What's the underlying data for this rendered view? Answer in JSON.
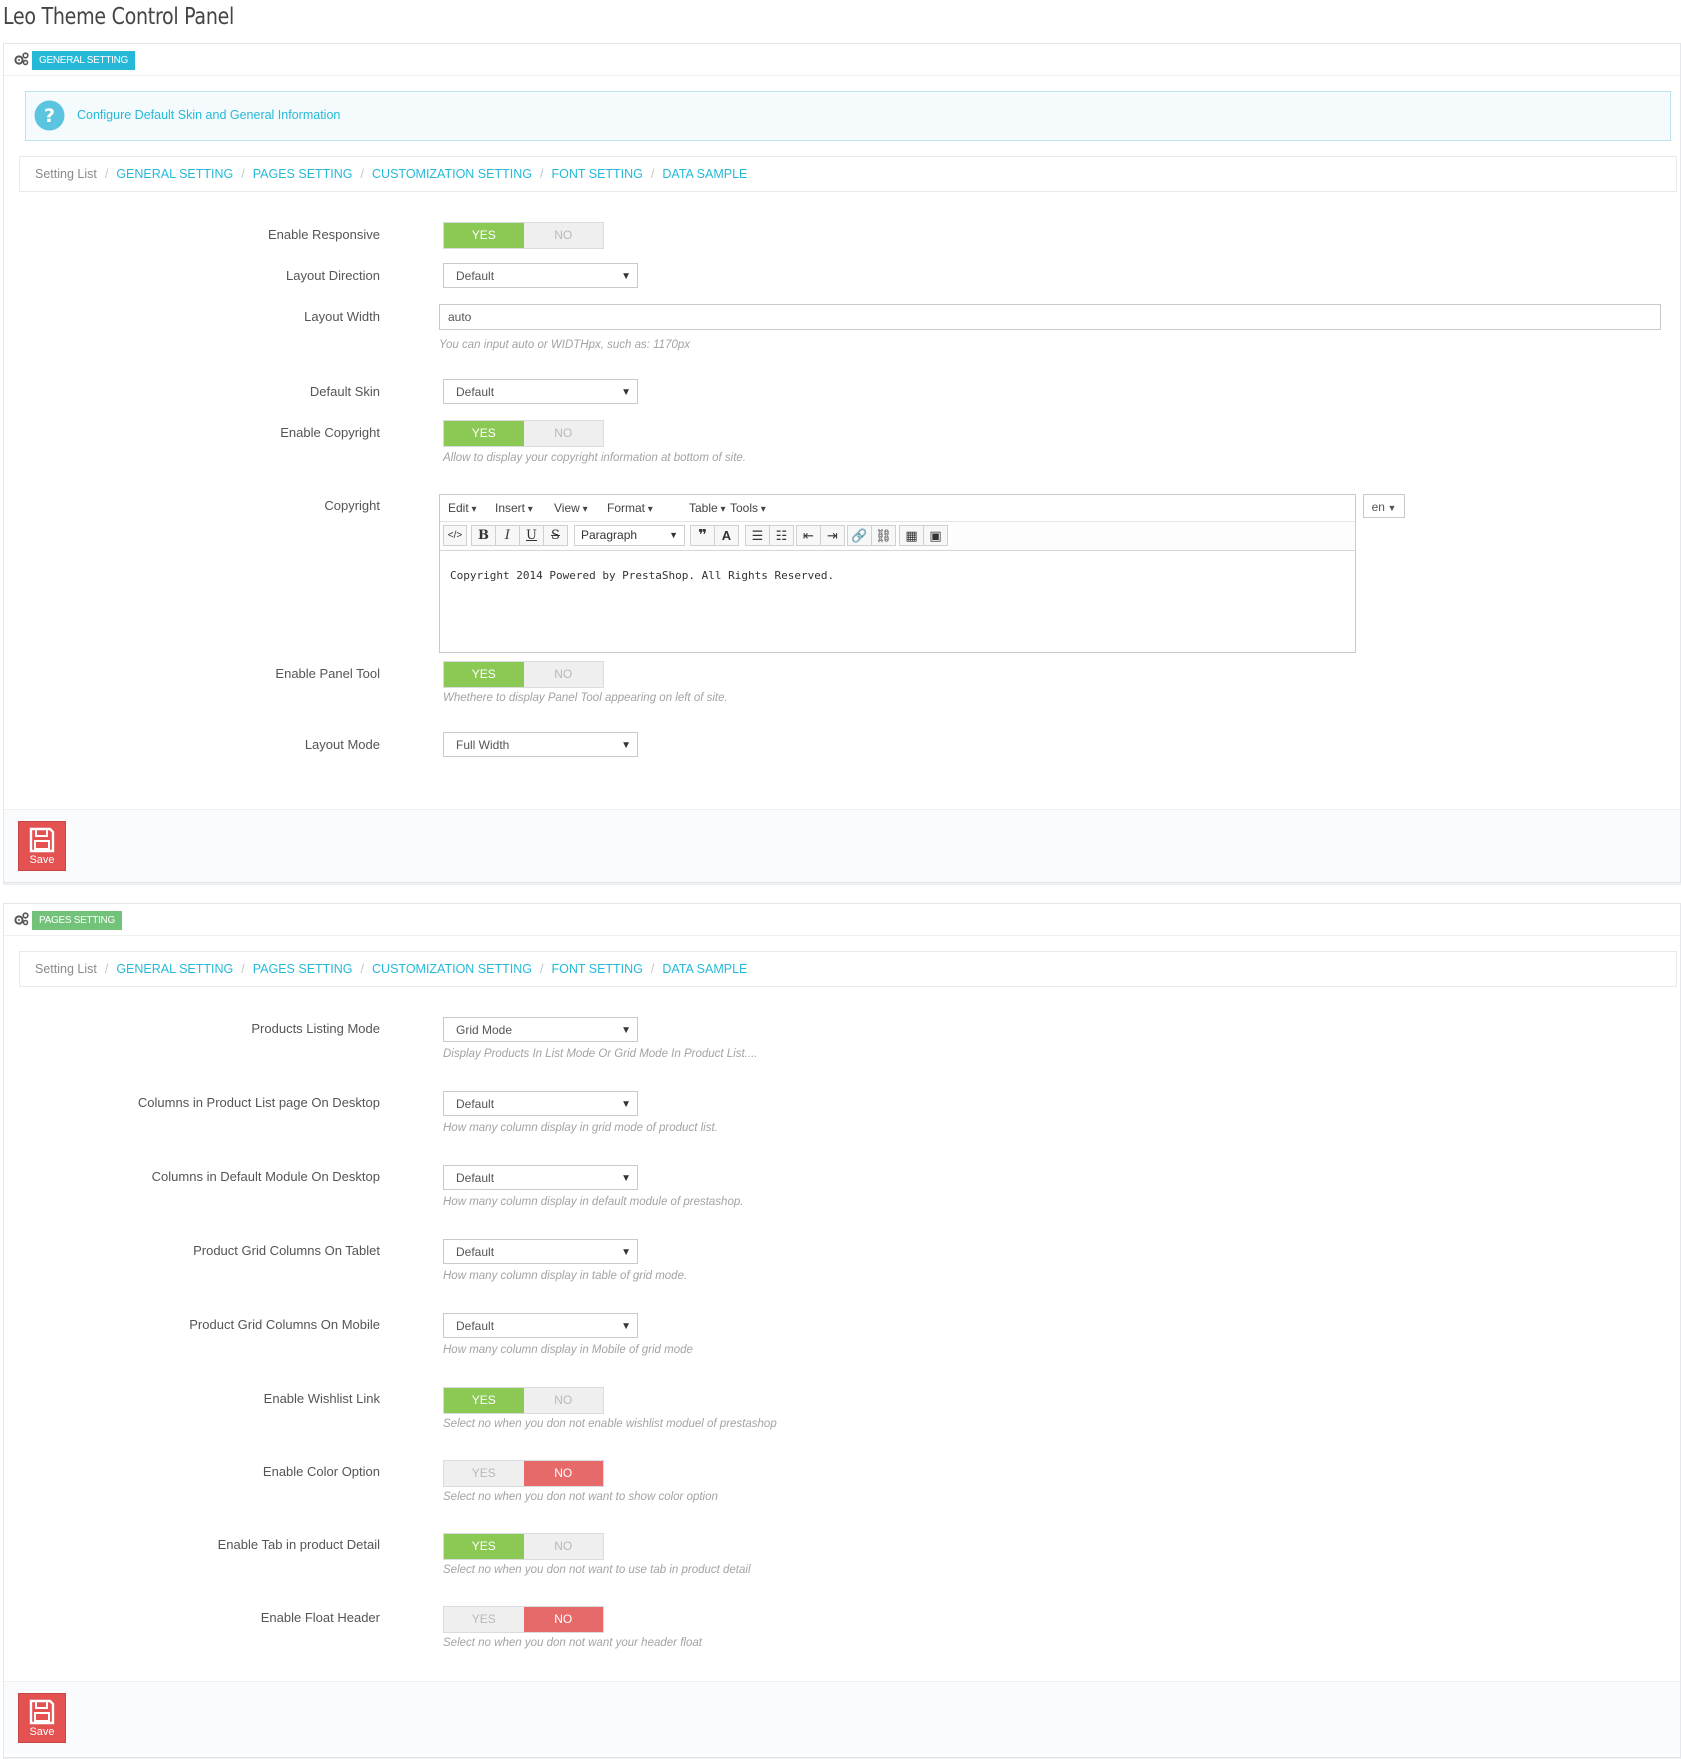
{
  "title": "Leo Theme Control Panel",
  "colors": {
    "accent": "#25b9d7",
    "yes": "#8bc954",
    "no": "#e76a6a",
    "save": "#e35151",
    "pages_badge": "#72c279"
  },
  "breadcrumb": {
    "home": "Setting List",
    "links": [
      "GENERAL SETTING",
      "PAGES SETTING",
      "CUSTOMIZATION SETTING",
      "FONT SETTING",
      "DATA SAMPLE"
    ]
  },
  "general": {
    "badge": "GENERAL SETTING",
    "info": "Configure Default Skin and General Information",
    "enable_responsive": {
      "label": "Enable Responsive",
      "yes": "YES",
      "no": "NO",
      "value": "yes"
    },
    "layout_direction": {
      "label": "Layout Direction",
      "value": "Default"
    },
    "layout_width": {
      "label": "Layout Width",
      "value": "auto",
      "help": "You can input auto or WIDTHpx, such as: 1170px"
    },
    "default_skin": {
      "label": "Default Skin",
      "value": "Default"
    },
    "enable_copyright": {
      "label": "Enable Copyright",
      "yes": "YES",
      "no": "NO",
      "value": "yes",
      "help": "Allow to display your copyright information at bottom of site."
    },
    "copyright": {
      "label": "Copyright",
      "menu": [
        "Edit",
        "Insert",
        "View",
        "Format",
        "Table",
        "Tools"
      ],
      "format_select": "Paragraph",
      "content": "Copyright 2014 Powered by PrestaShop. All Rights Reserved.",
      "lang": "en"
    },
    "enable_panel_tool": {
      "label": "Enable Panel Tool",
      "yes": "YES",
      "no": "NO",
      "value": "yes",
      "help": "Whethere to display Panel Tool appearing on left of site."
    },
    "layout_mode": {
      "label": "Layout Mode",
      "value": "Full Width"
    },
    "save_label": "Save"
  },
  "pages": {
    "badge": "PAGES SETTING",
    "listing_mode": {
      "label": "Products Listing Mode",
      "value": "Grid Mode",
      "help": "Display Products In List Mode Or Grid Mode In Product List...."
    },
    "cols_desktop": {
      "label": "Columns in Product List page On Desktop",
      "value": "Default",
      "help": "How many column display in grid mode of product list."
    },
    "cols_module": {
      "label": "Columns in Default Module On Desktop",
      "value": "Default",
      "help": "How many column display in default module of prestashop."
    },
    "cols_tablet": {
      "label": "Product Grid Columns On Tablet",
      "value": "Default",
      "help": "How many column display in table of grid mode."
    },
    "cols_mobile": {
      "label": "Product Grid Columns On Mobile",
      "value": "Default",
      "help": "How many column display in Mobile of grid mode"
    },
    "wishlist": {
      "label": "Enable Wishlist Link",
      "yes": "YES",
      "no": "NO",
      "value": "yes",
      "help": "Select no when you don not enable wishlist moduel of prestashop"
    },
    "color_option": {
      "label": "Enable Color Option",
      "yes": "YES",
      "no": "NO",
      "value": "no",
      "help": "Select no when you don not want to show color option"
    },
    "tab_detail": {
      "label": "Enable Tab in product Detail",
      "yes": "YES",
      "no": "NO",
      "value": "yes",
      "help": "Select no when you don not want to use tab in product detail"
    },
    "float_header": {
      "label": "Enable Float Header",
      "yes": "YES",
      "no": "NO",
      "value": "no",
      "help": "Select no when you don not want your header float"
    },
    "save_label": "Save"
  }
}
